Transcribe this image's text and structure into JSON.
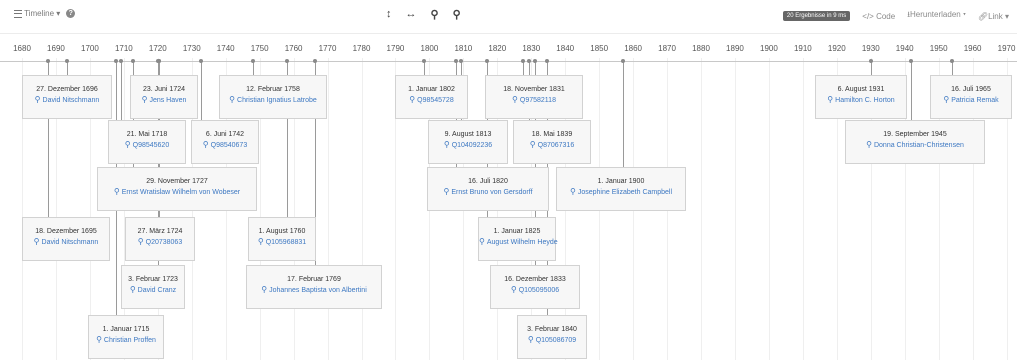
{
  "toolbar": {
    "timeline_label": "Timeline",
    "results_badge": "20 Ergebnisse in 9 ms",
    "code_label": "Code",
    "download_label": "Herunterladen",
    "link_label": "Link"
  },
  "axis_years": [
    "1680",
    "1690",
    "1700",
    "1710",
    "1720",
    "1730",
    "1740",
    "1750",
    "1760",
    "1770",
    "1780",
    "1790",
    "1800",
    "1810",
    "1820",
    "1830",
    "1840",
    "1850",
    "1860",
    "1870",
    "1880",
    "1890",
    "1900",
    "1910",
    "1920",
    "1930",
    "1940",
    "1950",
    "1960",
    "1970"
  ],
  "events": [
    {
      "date": "27. Dezember 1696",
      "label": "David Nitschmann"
    },
    {
      "date": "23. Juni 1724",
      "label": "Jens Haven"
    },
    {
      "date": "12. Februar 1758",
      "label": "Christian Ignatius Latrobe"
    },
    {
      "date": "1. Januar 1802",
      "label": "Q98545728"
    },
    {
      "date": "18. November 1831",
      "label": "Q97582118"
    },
    {
      "date": "6. August 1931",
      "label": "Hamilton C. Horton"
    },
    {
      "date": "16. Juli 1965",
      "label": "Patricia Remak"
    },
    {
      "date": "21. Mai 1718",
      "label": "Q98545620"
    },
    {
      "date": "6. Juni 1742",
      "label": "Q98540673"
    },
    {
      "date": "9. August 1813",
      "label": "Q104092236"
    },
    {
      "date": "18. Mai 1839",
      "label": "Q87067316"
    },
    {
      "date": "19. September 1945",
      "label": "Donna Christian-Christensen"
    },
    {
      "date": "29. November 1727",
      "label": "Ernst Wratislaw Wilhelm von Wobeser"
    },
    {
      "date": "16. Juli 1820",
      "label": "Ernst Bruno von Gersdorff"
    },
    {
      "date": "1. Januar 1900",
      "label": "Josephine Elizabeth Campbell"
    },
    {
      "date": "18. Dezember 1695",
      "label": "David Nitschmann"
    },
    {
      "date": "27. März 1724",
      "label": "Q20738063"
    },
    {
      "date": "1. August 1760",
      "label": "Q105968831"
    },
    {
      "date": "1. Januar 1825",
      "label": "August Wilhelm Heyde"
    },
    {
      "date": "3. Februar 1723",
      "label": "David Cranz"
    },
    {
      "date": "17. Februar 1769",
      "label": "Johannes Baptista von Albertini"
    },
    {
      "date": "16. Dezember 1833",
      "label": "Q105095006"
    },
    {
      "date": "1. Januar 1715",
      "label": "Christian Proffen"
    },
    {
      "date": "3. Februar 1840",
      "label": "Q105086709"
    }
  ]
}
